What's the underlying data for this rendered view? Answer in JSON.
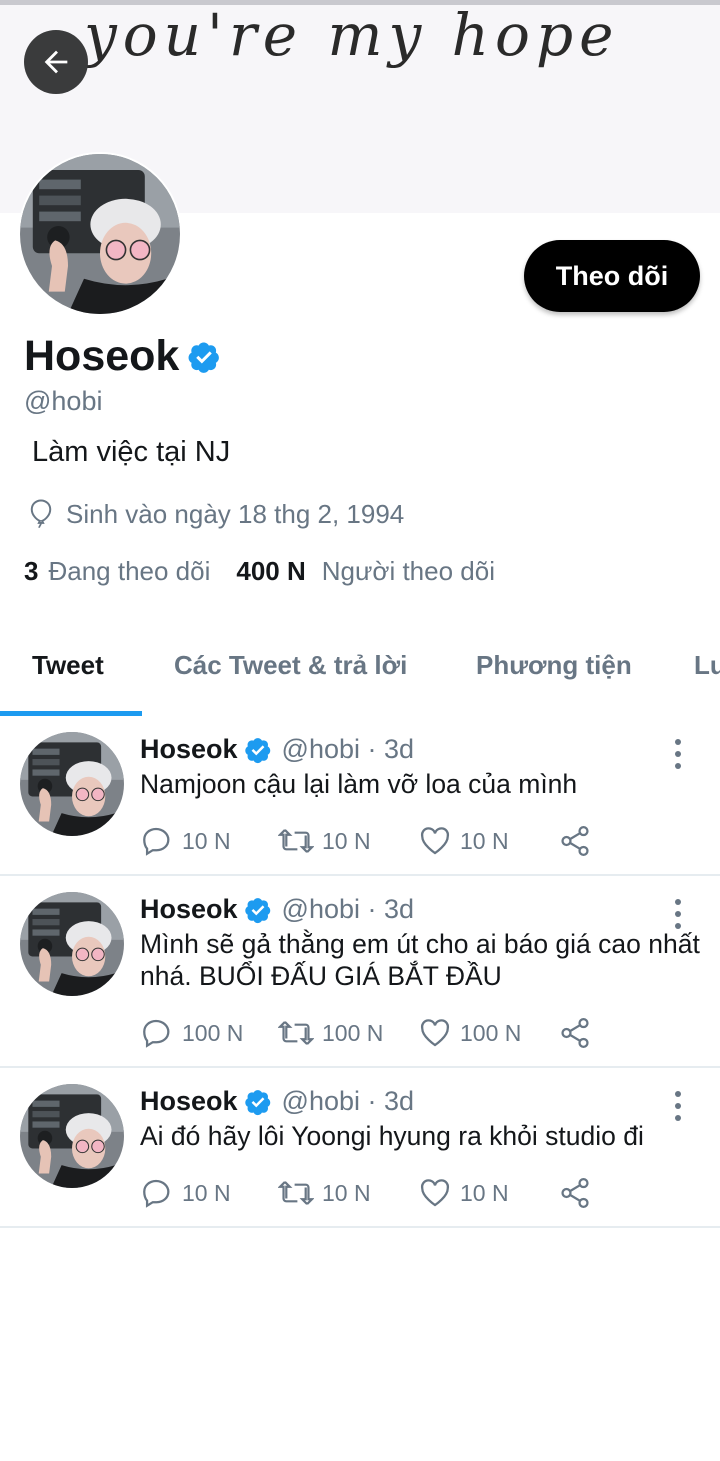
{
  "banner": {
    "text": "you're my hope"
  },
  "profile": {
    "follow_label": "Theo dõi",
    "name": "Hoseok",
    "handle": "@hobi",
    "bio": "Làm việc tại NJ",
    "birth": "Sinh vào ngày 18 thg 2, 1994",
    "following_count": "3",
    "following_label": "Đang theo dõi",
    "followers_count": "400 N",
    "followers_label": "Người theo dõi"
  },
  "tabs": [
    {
      "label": "Tweet",
      "active": true
    },
    {
      "label": "Các Tweet & trả lời"
    },
    {
      "label": "Phương tiện"
    },
    {
      "label": "Lư"
    }
  ],
  "tweets": [
    {
      "name": "Hoseok",
      "meta": "@hobi · 3d",
      "text": "Namjoon cậu lại làm vỡ loa của mình",
      "replies": "10 N",
      "retweets": "10 N",
      "likes": "10 N"
    },
    {
      "name": "Hoseok",
      "meta": "@hobi · 3d",
      "text": "Mình sẽ gả thằng em út cho ai báo giá cao nhất nhá. BUỔI ĐẤU GIÁ BẮT ĐẦU",
      "replies": "100 N",
      "retweets": "100 N",
      "likes": "100 N"
    },
    {
      "name": "Hoseok",
      "meta": "@hobi · 3d",
      "text": "Ai đó hãy lôi Yoongi hyung ra khỏi studio đi",
      "replies": "10 N",
      "retweets": "10 N",
      "likes": "10 N"
    }
  ],
  "colors": {
    "accent": "#1d9bf0",
    "muted": "#687684",
    "text": "#14171a"
  }
}
